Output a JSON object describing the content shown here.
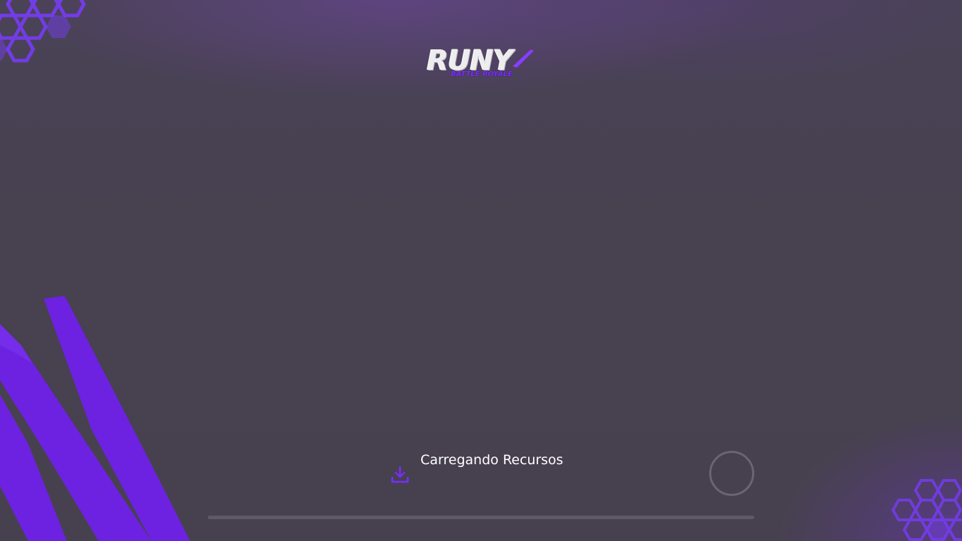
{
  "loading_screen": {
    "logo": {
      "title": "RUNY",
      "subtitle": "BATTLE ROYALE"
    },
    "status_text": "Carregando Recursos",
    "progress": 0,
    "icons": {
      "download": "download-icon",
      "spinner": "loading-spinner-icon"
    },
    "colors": {
      "background": "#474150",
      "accent": "#7a2bff",
      "progress_track": "#5f5869",
      "text": "#ffffff"
    }
  }
}
